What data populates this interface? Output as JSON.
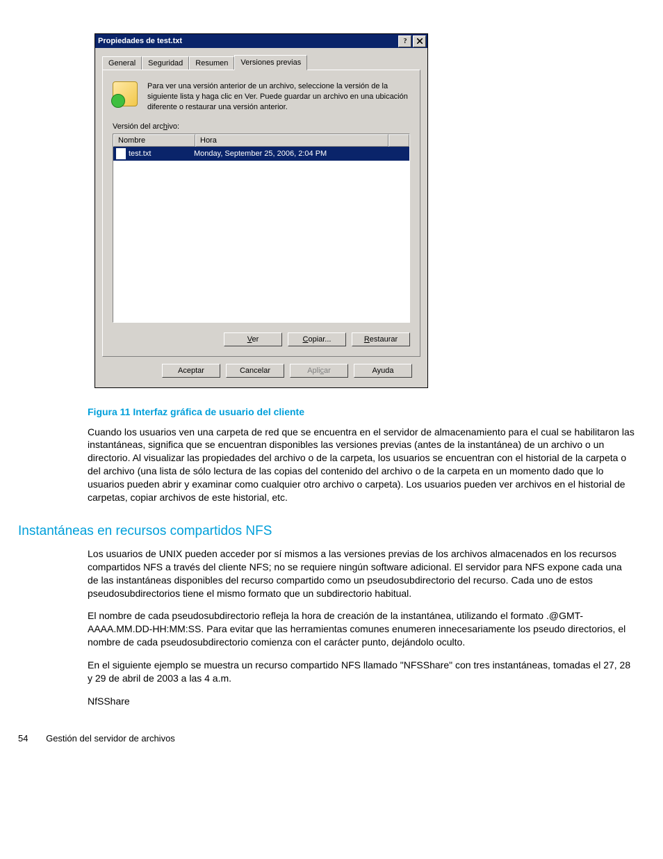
{
  "dialog": {
    "title": "Propiedades de test.txt",
    "tabs": [
      "General",
      "Seguridad",
      "Resumen",
      "Versiones previas"
    ],
    "active_tab_index": 3,
    "info_text": "Para ver una versión anterior de un archivo, seleccione la versión de la siguiente lista y haga clic en Ver.  Puede guardar un archivo en una ubicación diferente o restaurar una versión anterior.",
    "section_label_pre": "Versión del arc",
    "section_label_u": "h",
    "section_label_post": "ivo:",
    "columns": {
      "name": "Nombre",
      "time": "Hora"
    },
    "row": {
      "name": "test.txt",
      "time": "Monday, September 25, 2006, 2:04 PM"
    },
    "inner_buttons": {
      "view_u": "V",
      "view_post": "er",
      "copy_u": "C",
      "copy_post": "opiar...",
      "restore_u": "R",
      "restore_post": "estaurar"
    },
    "footer_buttons": {
      "ok": "Aceptar",
      "cancel": "Cancelar",
      "apply_pre": "Apli",
      "apply_u": "c",
      "apply_post": "ar",
      "help": "Ayuda"
    }
  },
  "doc": {
    "caption": "Figura 11 Interfaz gráfica de usuario del cliente",
    "para1": "Cuando los usuarios ven una carpeta de red que se encuentra en el servidor de almacenamiento para el cual se habilitaron las instantáneas, significa que se encuentran disponibles las versiones previas (antes de la instantánea) de un archivo o un directorio.  Al visualizar las propiedades del archivo o de la carpeta, los usuarios se encuentran con el historial de la carpeta o del archivo (una lista de sólo lectura de las copias del contenido del archivo o de la carpeta en un momento dado que lo usuarios pueden abrir y examinar como cualquier otro archivo o carpeta).  Los usuarios pueden ver archivos en el historial de carpetas, copiar archivos de este historial, etc.",
    "heading2": "Instantáneas en recursos compartidos NFS",
    "para2": "Los usuarios de UNIX pueden acceder por sí mismos a las versiones previas de los archivos almacenados en los recursos compartidos NFS a través del cliente NFS; no se requiere ningún software adicional. El servidor para NFS expone cada una de las instantáneas disponibles del recurso compartido como un pseudosubdirectorio del recurso.  Cada uno de estos pseudosubdirectorios tiene el mismo formato que un subdirectorio habitual.",
    "para3": "El nombre de cada pseudosubdirectorio refleja la hora de creación de la instantánea, utilizando el formato .@GMT-AAAA.MM.DD-HH:MM:SS. Para evitar que las herramientas comunes enumeren innecesariamente los pseudo directorios, el nombre de cada pseudosubdirectorio comienza con el carácter punto, dejándolo oculto.",
    "para4": "En el siguiente ejemplo se muestra un recurso compartido NFS llamado \"NFSShare\" con tres instantáneas, tomadas el 27, 28 y 29 de abril de 2003 a las 4 a.m.",
    "para5": "NfSShare",
    "page_number": "54",
    "footer_text": "Gestión del servidor de archivos"
  }
}
